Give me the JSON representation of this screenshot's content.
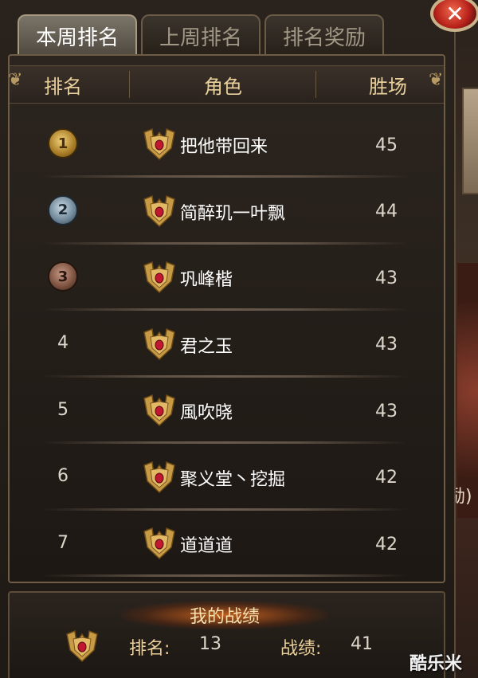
{
  "tabs": [
    {
      "label": "本周排名",
      "active": true
    },
    {
      "label": "上周排名",
      "active": false
    },
    {
      "label": "排名奖励",
      "active": false
    }
  ],
  "close_icon": "close-icon",
  "table": {
    "headers": {
      "rank": "排名",
      "role": "角色",
      "wins": "胜场"
    },
    "rows": [
      {
        "rank": "1",
        "medal": "gold",
        "name": "把他带回来",
        "wins": "45"
      },
      {
        "rank": "2",
        "medal": "silver",
        "name": "简醉玑一叶飘",
        "wins": "44"
      },
      {
        "rank": "3",
        "medal": "bronze",
        "name": "巩峰楷",
        "wins": "43"
      },
      {
        "rank": "4",
        "medal": "",
        "name": "君之玉",
        "wins": "43"
      },
      {
        "rank": "5",
        "medal": "",
        "name": "風吹晓",
        "wins": "43"
      },
      {
        "rank": "6",
        "medal": "",
        "name": "聚义堂丶挖掘",
        "wins": "42"
      },
      {
        "rank": "7",
        "medal": "",
        "name": "道道道",
        "wins": "42"
      }
    ]
  },
  "my_record": {
    "title": "我的战绩",
    "rank_label": "排名:",
    "rank_value": "13",
    "score_label": "战绩:",
    "score_value": "41"
  },
  "background": {
    "partial_text": "励)"
  },
  "watermark": "酷乐米",
  "colors": {
    "header_text": "#e9cf9c",
    "close_red": "#c8261d",
    "gold": "#d4a94a"
  }
}
